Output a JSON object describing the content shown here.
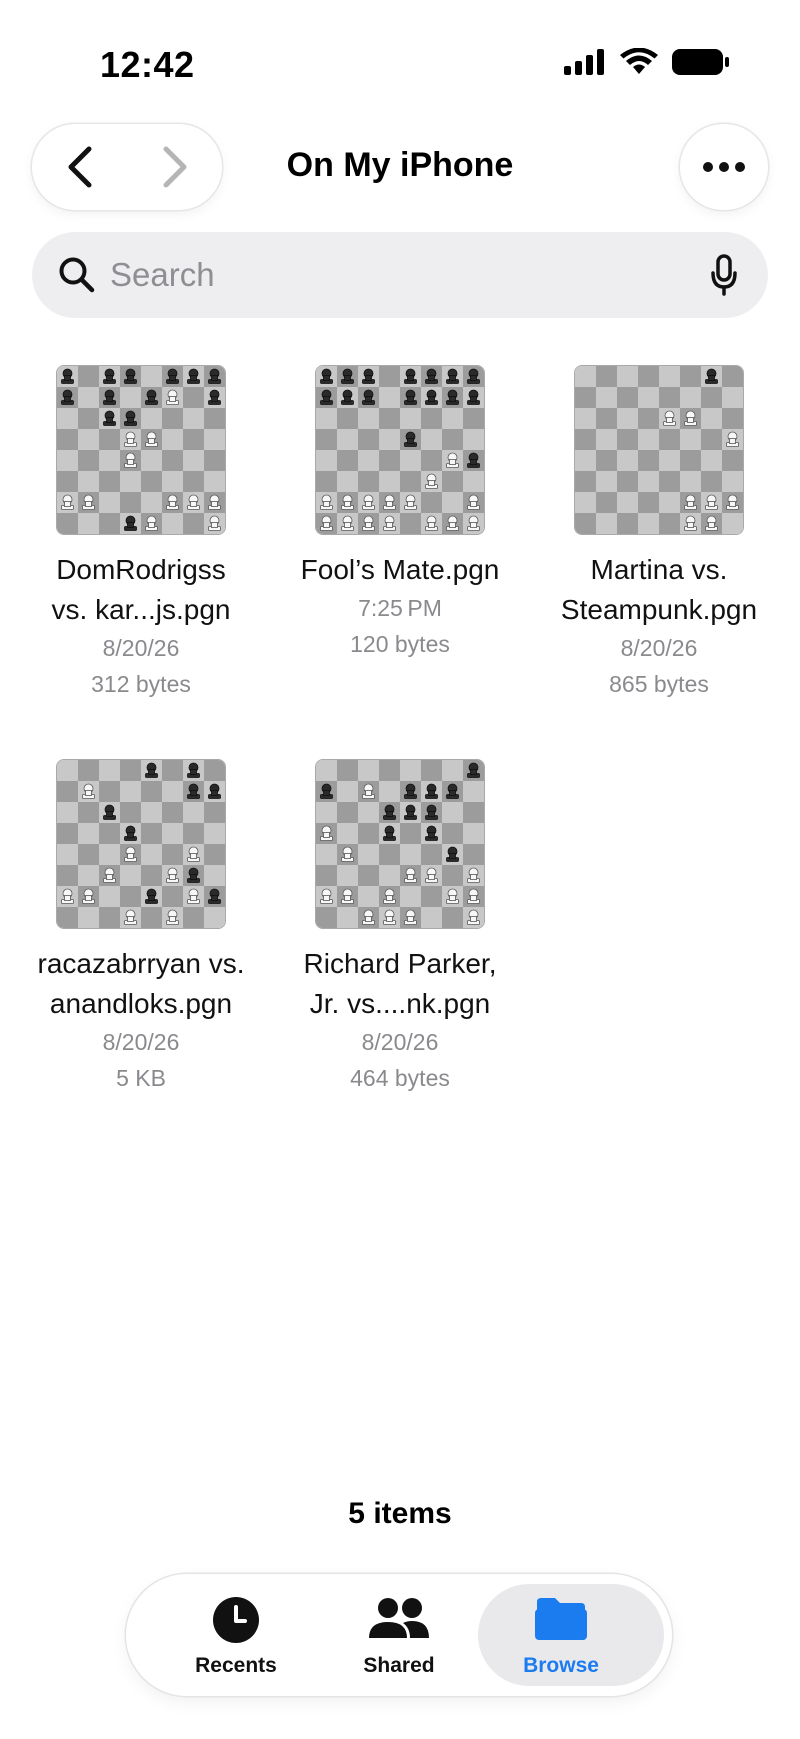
{
  "status_bar": {
    "time": "12:42"
  },
  "header": {
    "title": "On My iPhone"
  },
  "search": {
    "placeholder": "Search"
  },
  "files": [
    {
      "name_line1": "DomRodrigss",
      "name_line2": "vs. kar...js.pgn",
      "date": "8/20/26",
      "size": "312 bytes",
      "thumbnail": "chess-board-thumbnail"
    },
    {
      "name_line1": "Fool’s Mate.pgn",
      "name_line2": "",
      "date": "7:25 PM",
      "size": "120 bytes",
      "thumbnail": "chess-board-thumbnail"
    },
    {
      "name_line1": "Martina vs.",
      "name_line2": "Steampunk.pgn",
      "date": "8/20/26",
      "size": "865 bytes",
      "thumbnail": "chess-board-thumbnail"
    },
    {
      "name_line1": "racazabrryan vs.",
      "name_line2": "anandloks.pgn",
      "date": "8/20/26",
      "size": "5 KB",
      "thumbnail": "chess-board-thumbnail"
    },
    {
      "name_line1": "Richard Parker,",
      "name_line2": "Jr. vs....nk.pgn",
      "date": "8/20/26",
      "size": "464 bytes",
      "thumbnail": "chess-board-thumbnail"
    }
  ],
  "footer": {
    "items_count": "5 items"
  },
  "tabs": [
    {
      "label": "Recents",
      "icon": "clock-icon",
      "active": false
    },
    {
      "label": "Shared",
      "icon": "people-icon",
      "active": false
    },
    {
      "label": "Browse",
      "icon": "folder-icon",
      "active": true
    }
  ],
  "colors": {
    "accent": "#1b7cf0",
    "board_light": "#c8c8c8",
    "board_dark": "#9c9c9c"
  }
}
